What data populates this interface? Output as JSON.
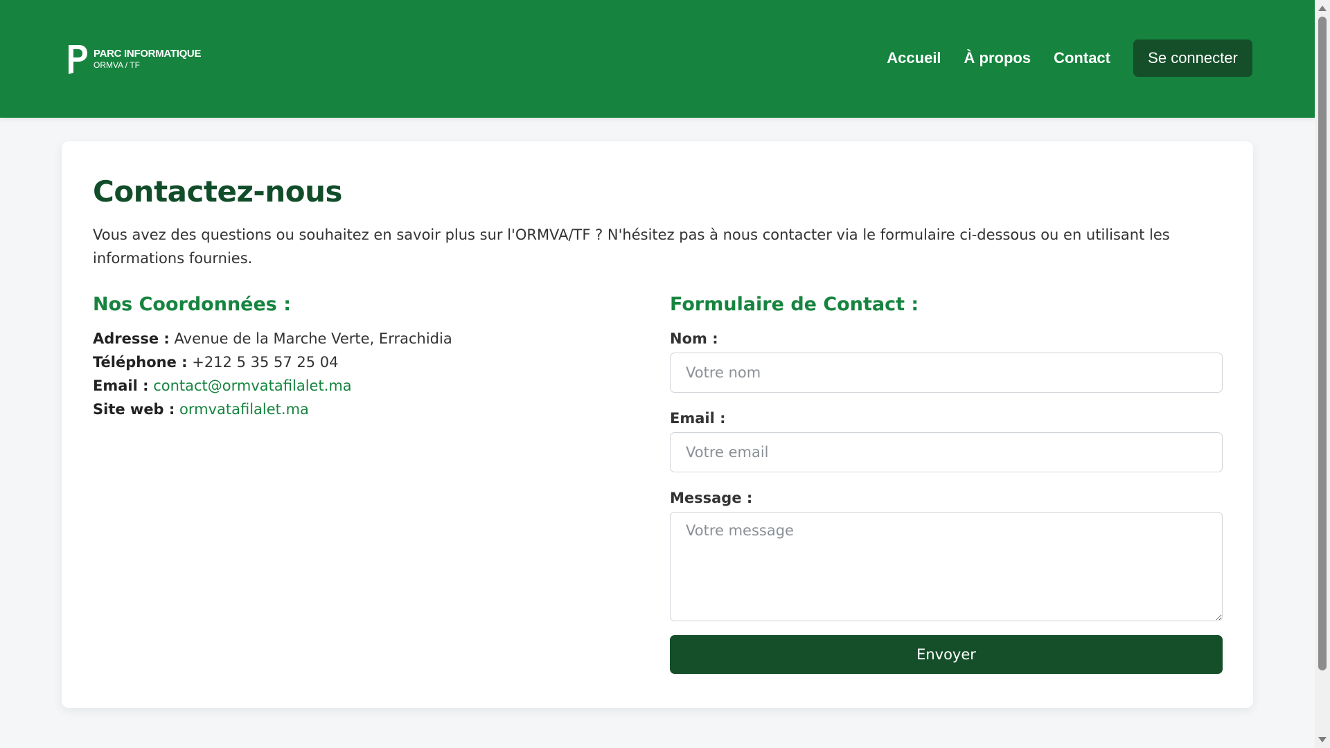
{
  "brand": {
    "title": "PARC INFORMATIQUE",
    "subtitle": "ORMVA / TF"
  },
  "nav": {
    "links": [
      "Accueil",
      "À propos",
      "Contact"
    ],
    "login_label": "Se connecter"
  },
  "main": {
    "title": "Contactez-nous",
    "intro": "Vous avez des questions ou souhaitez en savoir plus sur l'ORMVA/TF ? N'hésitez pas à nous contacter via le formulaire ci-dessous ou en utilisant les informations fournies."
  },
  "coordinates": {
    "title": "Nos Coordonnées :",
    "address_label": "Adresse :",
    "address_value": "Avenue de la Marche Verte, Errachidia",
    "phone_label": "Téléphone :",
    "phone_value": "+212 5 35 57 25 04",
    "email_label": "Email :",
    "email_value": "contact@ormvatafilalet.ma",
    "website_label": "Site web :",
    "website_value": "ormvatafilalet.ma"
  },
  "form": {
    "title": "Formulaire de Contact :",
    "name_label": "Nom :",
    "name_placeholder": "Votre nom",
    "name_value": "",
    "email_label": "Email :",
    "email_placeholder": "Votre email",
    "email_value": "",
    "message_label": "Message :",
    "message_placeholder": "Votre message",
    "message_value": "",
    "submit_label": "Envoyer"
  },
  "colors": {
    "header_bg": "#16843f",
    "dark_green": "#154f2a",
    "title_green": "#124d2a",
    "link_green": "#16843f"
  }
}
